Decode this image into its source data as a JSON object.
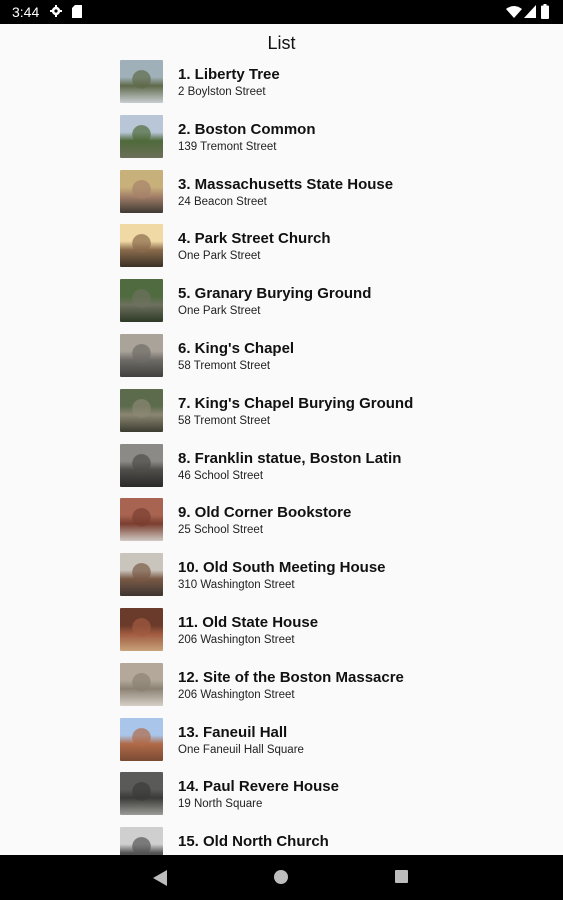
{
  "status_bar": {
    "time": "3:44",
    "icons": [
      "settings-gear-icon",
      "sd-card-icon",
      "wifi-icon",
      "cell-signal-icon",
      "battery-icon"
    ]
  },
  "page": {
    "title": "List"
  },
  "items": [
    {
      "title": "1. Liberty Tree",
      "subtitle": "2 Boylston Street",
      "thumb_colors": [
        "#9fb0b8",
        "#5f6a4a",
        "#c9cdd2"
      ]
    },
    {
      "title": "2. Boston Common",
      "subtitle": "139 Tremont Street",
      "thumb_colors": [
        "#b9c6d8",
        "#4f6a3a",
        "#6c6f5a"
      ]
    },
    {
      "title": "3. Massachusetts State House",
      "subtitle": "24 Beacon Street",
      "thumb_colors": [
        "#c8b07a",
        "#a6826a",
        "#3f3a33"
      ]
    },
    {
      "title": "4. Park Street Church",
      "subtitle": "One Park Street",
      "thumb_colors": [
        "#f0d9a4",
        "#8a6b4c",
        "#3a3026"
      ]
    },
    {
      "title": "5. Granary Burying Ground",
      "subtitle": "One Park Street",
      "thumb_colors": [
        "#4f6b3f",
        "#6d705e",
        "#2d3a26"
      ]
    },
    {
      "title": "6. King's Chapel",
      "subtitle": "58 Tremont Street",
      "thumb_colors": [
        "#a9a39a",
        "#6f6c67",
        "#40403e"
      ]
    },
    {
      "title": "7. King's Chapel Burying Ground",
      "subtitle": "58 Tremont Street",
      "thumb_colors": [
        "#5c6b4c",
        "#8b8672",
        "#3c3c30"
      ]
    },
    {
      "title": "8. Franklin statue, Boston Latin",
      "subtitle": "46 School Street",
      "thumb_colors": [
        "#8c8a86",
        "#4f4d4a",
        "#2a2a28"
      ]
    },
    {
      "title": "9. Old Corner Bookstore",
      "subtitle": "25 School Street",
      "thumb_colors": [
        "#a86450",
        "#7a3e30",
        "#cfc9c2"
      ]
    },
    {
      "title": "10. Old South Meeting House",
      "subtitle": "310 Washington Street",
      "thumb_colors": [
        "#c9c4bc",
        "#7a5a46",
        "#3c3430"
      ]
    },
    {
      "title": "11. Old State House",
      "subtitle": "206 Washington Street",
      "thumb_colors": [
        "#6a3a2a",
        "#a05a40",
        "#c7a27a"
      ]
    },
    {
      "title": "12. Site of the Boston Massacre",
      "subtitle": "206 Washington Street",
      "thumb_colors": [
        "#b3a89a",
        "#8c8274",
        "#d5cfc6"
      ]
    },
    {
      "title": "13. Faneuil Hall",
      "subtitle": "One Faneuil Hall Square",
      "thumb_colors": [
        "#a9c6ea",
        "#b06a48",
        "#7a4a34"
      ]
    },
    {
      "title": "14. Paul Revere House",
      "subtitle": "19 North Square",
      "thumb_colors": [
        "#5a5a58",
        "#3a3a38",
        "#9a9a96"
      ]
    },
    {
      "title": "15. Old North Church",
      "subtitle": "",
      "thumb_colors": [
        "#cfcfcf",
        "#555",
        "#2a2a2a"
      ]
    }
  ],
  "nav_bar": {
    "icons": [
      "back-icon",
      "home-icon",
      "recent-apps-icon"
    ]
  }
}
